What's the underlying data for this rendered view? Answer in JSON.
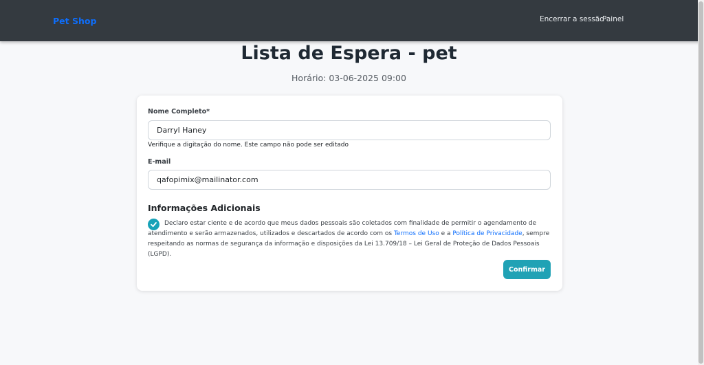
{
  "navbar": {
    "brand": "Pet Shop",
    "links": [
      {
        "label": "Encerrar a sessão"
      },
      {
        "label": "Painel"
      }
    ]
  },
  "page": {
    "title": "Lista de Espera - pet",
    "schedule": "Horário: 03-06-2025 09:00"
  },
  "form": {
    "name_label": "Nome Completo*",
    "name_value": "Darryl Haney",
    "name_help": "Verifique a digitação do nome. Este campo não pode ser editado",
    "email_label": "E-mail",
    "email_value": "qafopimix@mailinator.com",
    "section_title": "Informações Adicionais",
    "consent_part1": "Declaro estar ciente e de acordo que meus dados pessoais são coletados com finalidade de permitir o agendamento de atendimento e serão armazenados, utilizados e descartados de acordo com os ",
    "terms_link": "Termos de Uso",
    "consent_part2": " e a ",
    "privacy_link": "Política de Privacidade",
    "consent_part3": ", sempre respeitando as normas de segurança da informação e disposições da Lei 13.709/18 – Lei Geral de Proteção de Dados Pessoais (LGPD).",
    "submit_label": "Confirmar"
  },
  "colors": {
    "navbar": "#343a40",
    "brand": "#0d6efd",
    "accent": "#20a2b5"
  }
}
